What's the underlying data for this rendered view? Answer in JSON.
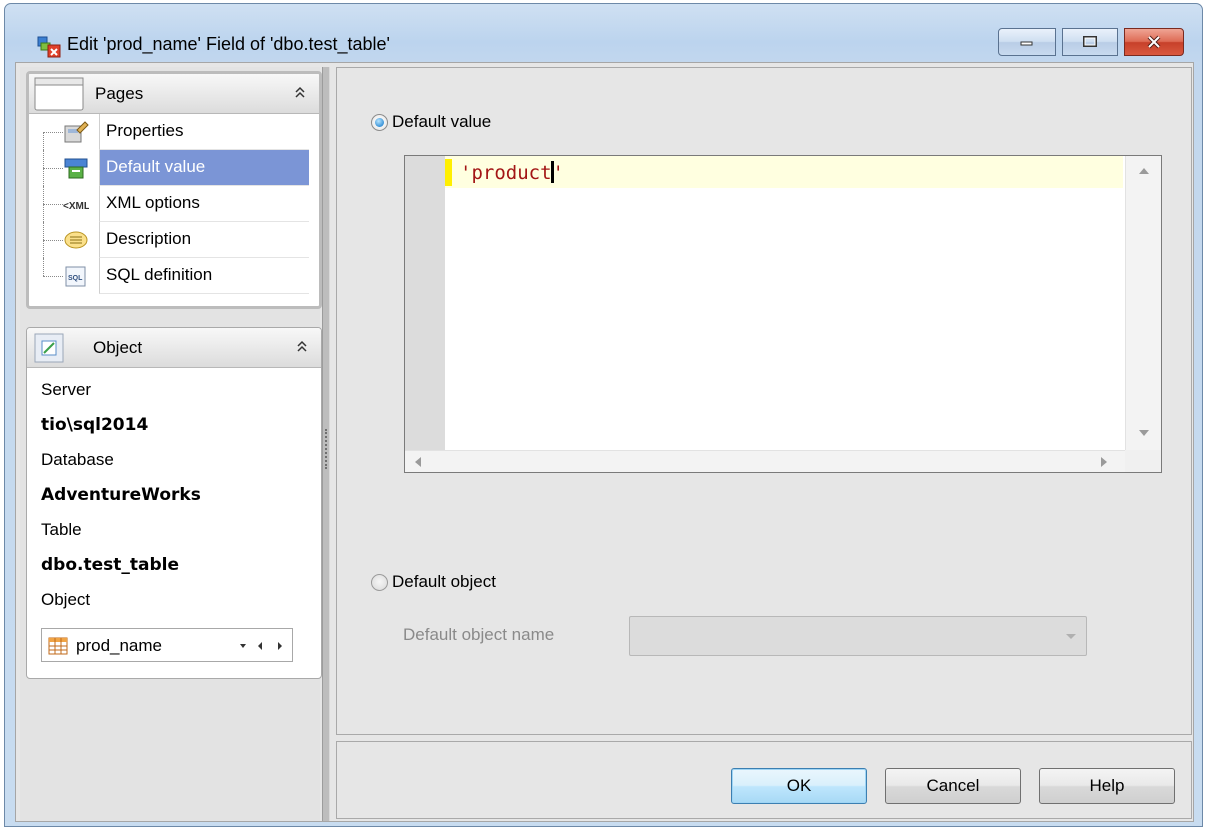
{
  "window": {
    "title": "Edit 'prod_name' Field of 'dbo.test_table'",
    "controls": [
      "minimize-icon",
      "maximize-icon",
      "close-icon"
    ]
  },
  "pages_panel": {
    "header": "Pages",
    "items": [
      {
        "label": "Properties",
        "icon": "properties-icon",
        "selected": false
      },
      {
        "label": "Default value",
        "icon": "default-value-icon",
        "selected": true
      },
      {
        "label": "XML options",
        "icon": "xml-icon",
        "selected": false
      },
      {
        "label": "Description",
        "icon": "description-icon",
        "selected": false
      },
      {
        "label": "SQL definition",
        "icon": "sql-icon",
        "selected": false
      }
    ]
  },
  "object_panel": {
    "header": "Object",
    "server_label": "Server",
    "server_value": "tio\\sql2014",
    "database_label": "Database",
    "database_value": "AdventureWorks",
    "table_label": "Table",
    "table_value": "dbo.test_table",
    "object_label": "Object",
    "object_value": "prod_name"
  },
  "main": {
    "default_value_option": {
      "label": "Default value",
      "checked": true
    },
    "editor": {
      "code_line": "'product'"
    },
    "default_object_option": {
      "label": "Default object",
      "checked": false
    },
    "default_object_name_label": "Default object name",
    "default_object_name_value": ""
  },
  "buttons": {
    "ok": "OK",
    "cancel": "Cancel",
    "help": "Help"
  },
  "colors": {
    "selection": "#7b95d6",
    "string_literal": "#a31515",
    "current_line": "#ffffe0",
    "change_marker": "#ffef00"
  }
}
